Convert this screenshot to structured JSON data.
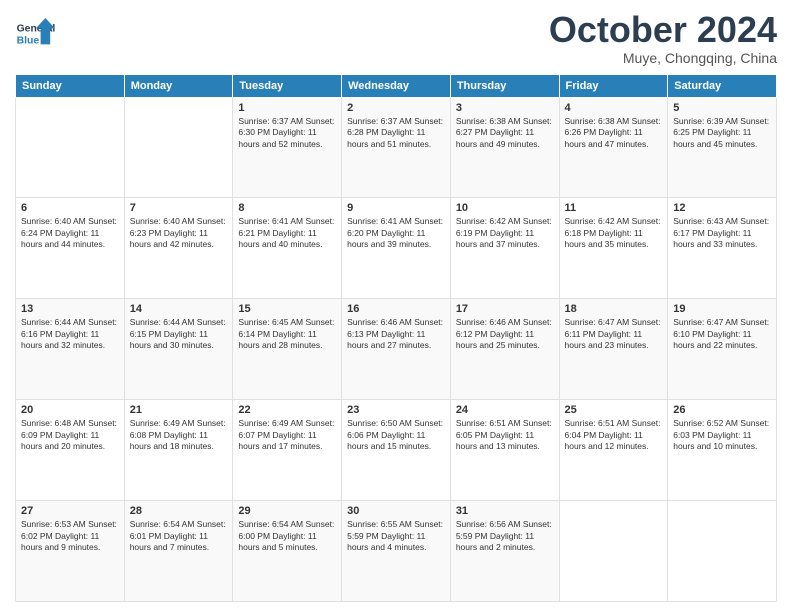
{
  "header": {
    "logo": {
      "general": "General",
      "blue": "Blue"
    },
    "title": "October 2024",
    "location": "Muye, Chongqing, China"
  },
  "calendar": {
    "weekdays": [
      "Sunday",
      "Monday",
      "Tuesday",
      "Wednesday",
      "Thursday",
      "Friday",
      "Saturday"
    ],
    "weeks": [
      [
        {
          "day": "",
          "info": ""
        },
        {
          "day": "",
          "info": ""
        },
        {
          "day": "1",
          "info": "Sunrise: 6:37 AM\nSunset: 6:30 PM\nDaylight: 11 hours and 52 minutes."
        },
        {
          "day": "2",
          "info": "Sunrise: 6:37 AM\nSunset: 6:28 PM\nDaylight: 11 hours and 51 minutes."
        },
        {
          "day": "3",
          "info": "Sunrise: 6:38 AM\nSunset: 6:27 PM\nDaylight: 11 hours and 49 minutes."
        },
        {
          "day": "4",
          "info": "Sunrise: 6:38 AM\nSunset: 6:26 PM\nDaylight: 11 hours and 47 minutes."
        },
        {
          "day": "5",
          "info": "Sunrise: 6:39 AM\nSunset: 6:25 PM\nDaylight: 11 hours and 45 minutes."
        }
      ],
      [
        {
          "day": "6",
          "info": "Sunrise: 6:40 AM\nSunset: 6:24 PM\nDaylight: 11 hours and 44 minutes."
        },
        {
          "day": "7",
          "info": "Sunrise: 6:40 AM\nSunset: 6:23 PM\nDaylight: 11 hours and 42 minutes."
        },
        {
          "day": "8",
          "info": "Sunrise: 6:41 AM\nSunset: 6:21 PM\nDaylight: 11 hours and 40 minutes."
        },
        {
          "day": "9",
          "info": "Sunrise: 6:41 AM\nSunset: 6:20 PM\nDaylight: 11 hours and 39 minutes."
        },
        {
          "day": "10",
          "info": "Sunrise: 6:42 AM\nSunset: 6:19 PM\nDaylight: 11 hours and 37 minutes."
        },
        {
          "day": "11",
          "info": "Sunrise: 6:42 AM\nSunset: 6:18 PM\nDaylight: 11 hours and 35 minutes."
        },
        {
          "day": "12",
          "info": "Sunrise: 6:43 AM\nSunset: 6:17 PM\nDaylight: 11 hours and 33 minutes."
        }
      ],
      [
        {
          "day": "13",
          "info": "Sunrise: 6:44 AM\nSunset: 6:16 PM\nDaylight: 11 hours and 32 minutes."
        },
        {
          "day": "14",
          "info": "Sunrise: 6:44 AM\nSunset: 6:15 PM\nDaylight: 11 hours and 30 minutes."
        },
        {
          "day": "15",
          "info": "Sunrise: 6:45 AM\nSunset: 6:14 PM\nDaylight: 11 hours and 28 minutes."
        },
        {
          "day": "16",
          "info": "Sunrise: 6:46 AM\nSunset: 6:13 PM\nDaylight: 11 hours and 27 minutes."
        },
        {
          "day": "17",
          "info": "Sunrise: 6:46 AM\nSunset: 6:12 PM\nDaylight: 11 hours and 25 minutes."
        },
        {
          "day": "18",
          "info": "Sunrise: 6:47 AM\nSunset: 6:11 PM\nDaylight: 11 hours and 23 minutes."
        },
        {
          "day": "19",
          "info": "Sunrise: 6:47 AM\nSunset: 6:10 PM\nDaylight: 11 hours and 22 minutes."
        }
      ],
      [
        {
          "day": "20",
          "info": "Sunrise: 6:48 AM\nSunset: 6:09 PM\nDaylight: 11 hours and 20 minutes."
        },
        {
          "day": "21",
          "info": "Sunrise: 6:49 AM\nSunset: 6:08 PM\nDaylight: 11 hours and 18 minutes."
        },
        {
          "day": "22",
          "info": "Sunrise: 6:49 AM\nSunset: 6:07 PM\nDaylight: 11 hours and 17 minutes."
        },
        {
          "day": "23",
          "info": "Sunrise: 6:50 AM\nSunset: 6:06 PM\nDaylight: 11 hours and 15 minutes."
        },
        {
          "day": "24",
          "info": "Sunrise: 6:51 AM\nSunset: 6:05 PM\nDaylight: 11 hours and 13 minutes."
        },
        {
          "day": "25",
          "info": "Sunrise: 6:51 AM\nSunset: 6:04 PM\nDaylight: 11 hours and 12 minutes."
        },
        {
          "day": "26",
          "info": "Sunrise: 6:52 AM\nSunset: 6:03 PM\nDaylight: 11 hours and 10 minutes."
        }
      ],
      [
        {
          "day": "27",
          "info": "Sunrise: 6:53 AM\nSunset: 6:02 PM\nDaylight: 11 hours and 9 minutes."
        },
        {
          "day": "28",
          "info": "Sunrise: 6:54 AM\nSunset: 6:01 PM\nDaylight: 11 hours and 7 minutes."
        },
        {
          "day": "29",
          "info": "Sunrise: 6:54 AM\nSunset: 6:00 PM\nDaylight: 11 hours and 5 minutes."
        },
        {
          "day": "30",
          "info": "Sunrise: 6:55 AM\nSunset: 5:59 PM\nDaylight: 11 hours and 4 minutes."
        },
        {
          "day": "31",
          "info": "Sunrise: 6:56 AM\nSunset: 5:59 PM\nDaylight: 11 hours and 2 minutes."
        },
        {
          "day": "",
          "info": ""
        },
        {
          "day": "",
          "info": ""
        }
      ]
    ]
  }
}
